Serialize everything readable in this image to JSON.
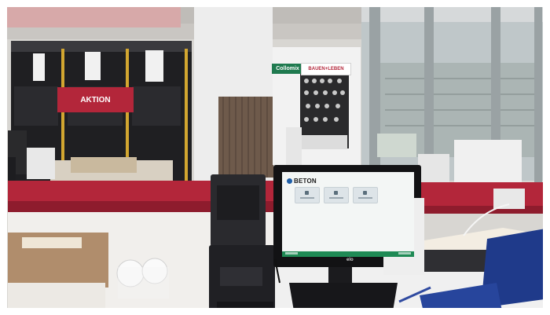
{
  "signs": {
    "aktion": "AKTION",
    "collomix": "Collomix",
    "bauen_leben": "BAUEN+LEBEN"
  },
  "pos_screen": {
    "brand": "BETON",
    "tiles": 3
  },
  "monitor_badge": "elo",
  "colors": {
    "counter_red": "#b3263a",
    "screen_green": "#1f8a55"
  }
}
